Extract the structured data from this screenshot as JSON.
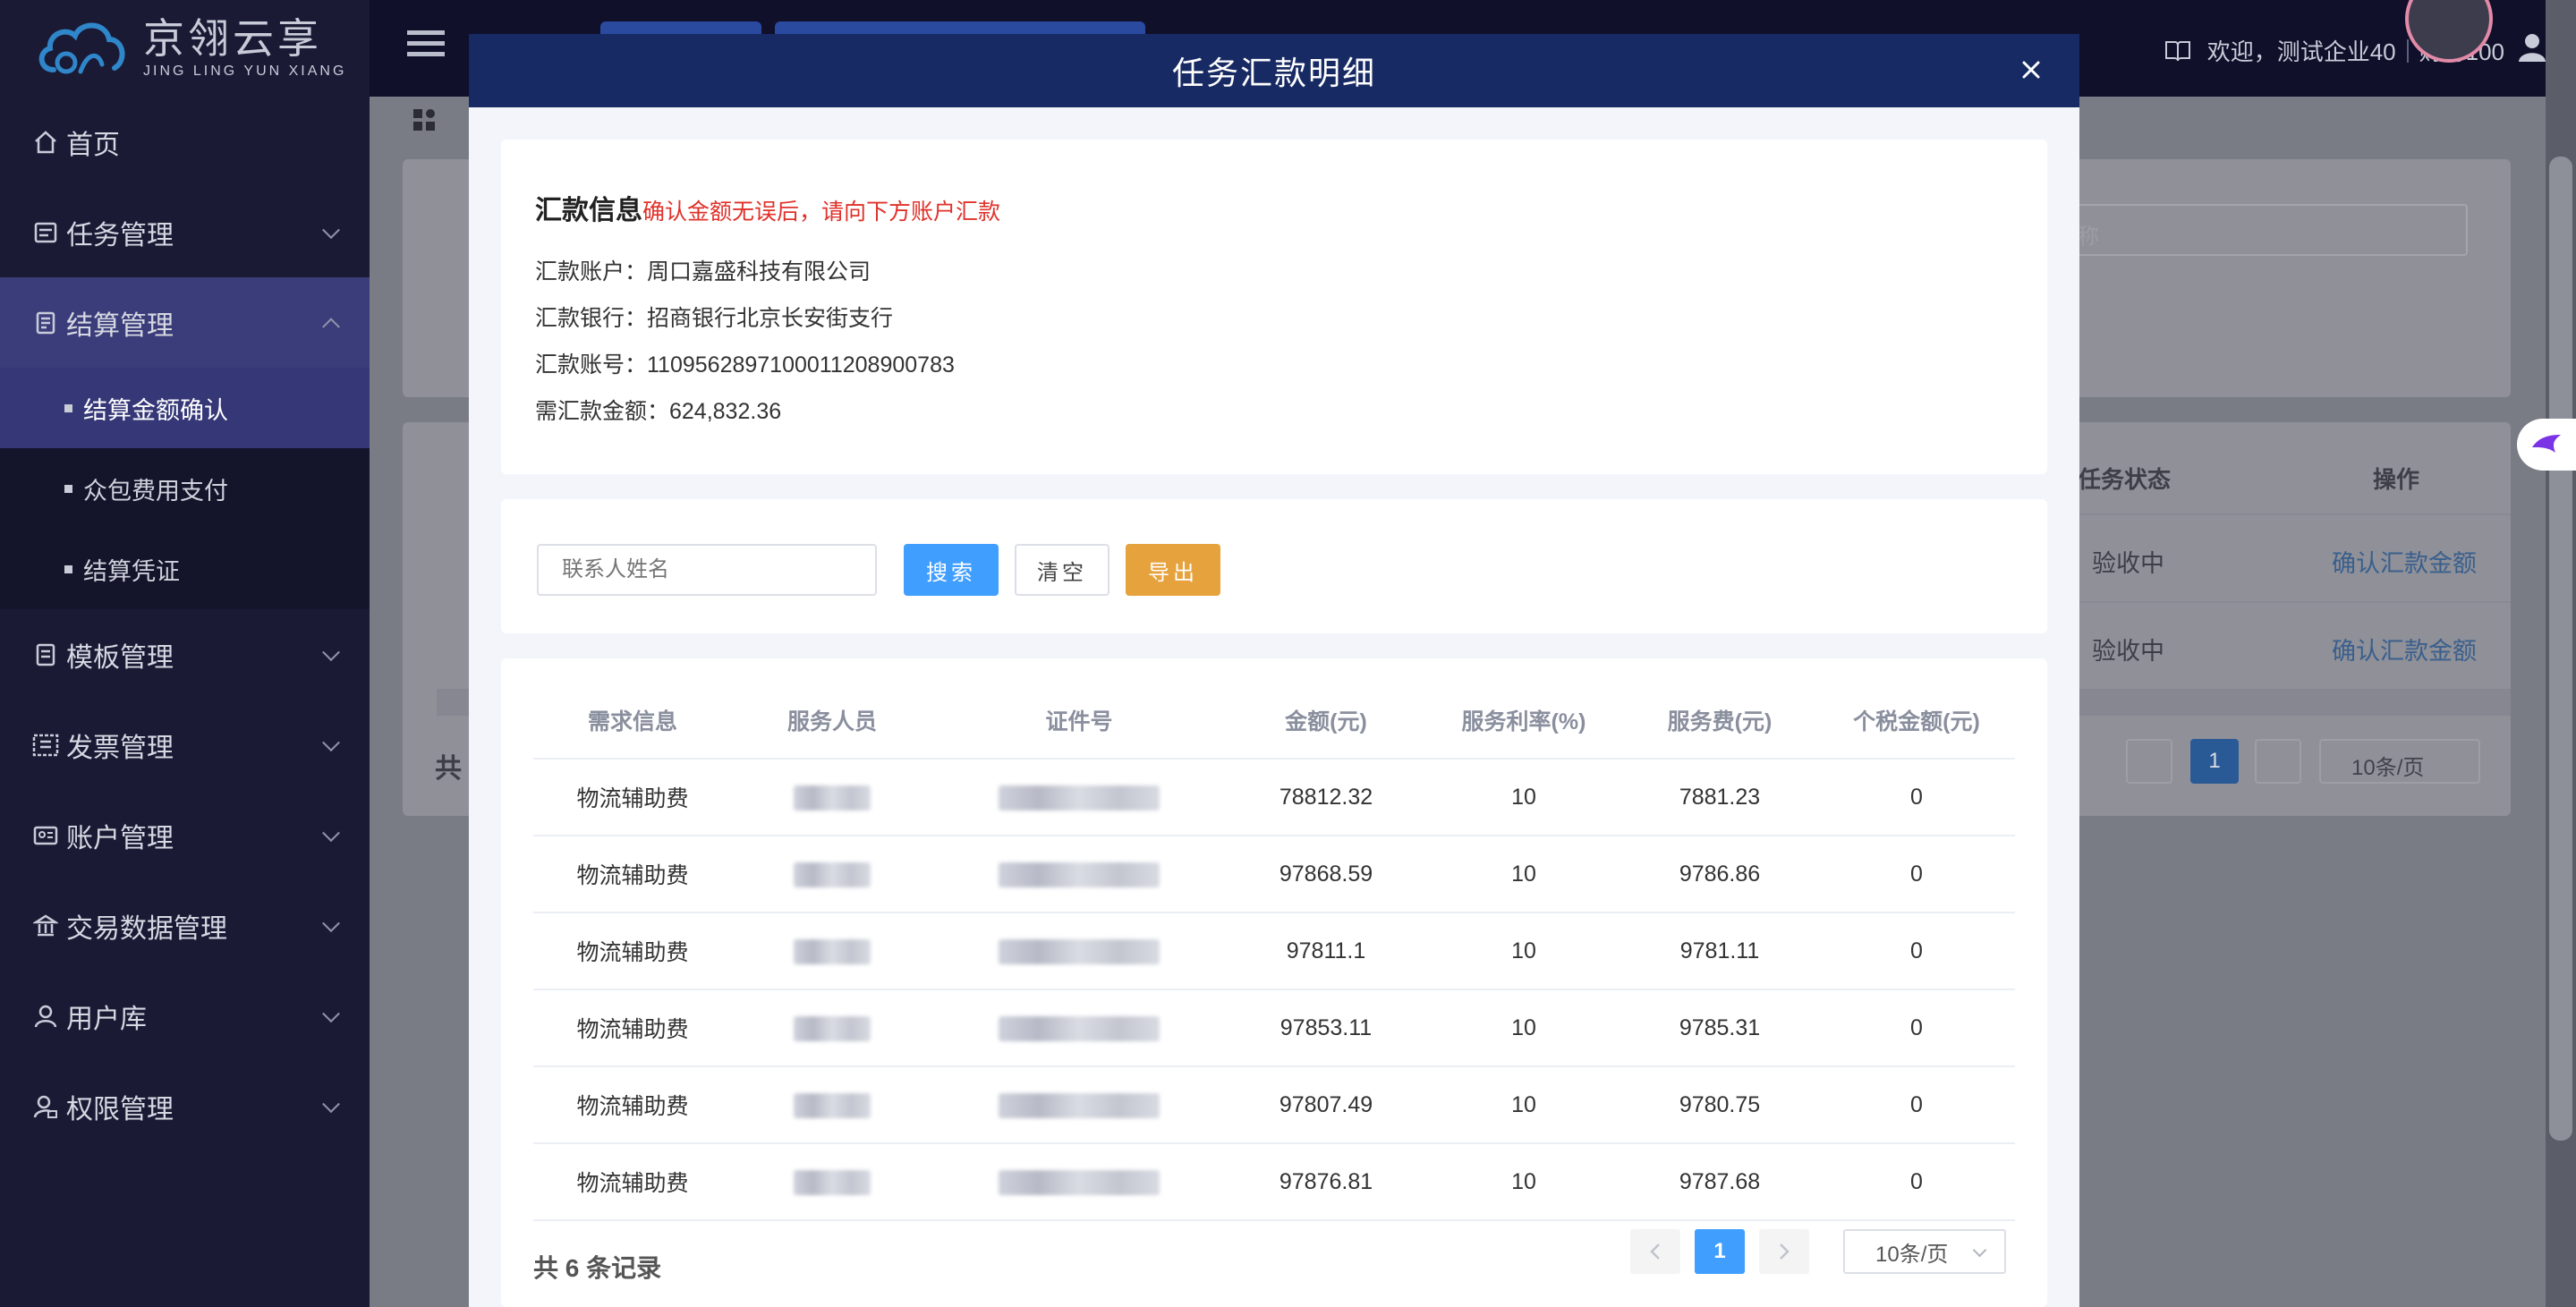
{
  "app": {
    "logo_cn": "京翎云享",
    "logo_en": "JING LING YUN XIANG"
  },
  "header": {
    "welcome": "欢迎，测试企业40",
    "role": "财务100"
  },
  "sidebar": {
    "items": [
      {
        "label": "首页",
        "icon": "home-icon"
      },
      {
        "label": "任务管理",
        "icon": "task-icon"
      },
      {
        "label": "结算管理",
        "icon": "settlement-icon",
        "expanded": true,
        "children": [
          {
            "label": "结算金额确认",
            "active": true
          },
          {
            "label": "众包费用支付"
          },
          {
            "label": "结算凭证"
          }
        ]
      },
      {
        "label": "模板管理",
        "icon": "template-icon"
      },
      {
        "label": "发票管理",
        "icon": "invoice-icon"
      },
      {
        "label": "账户管理",
        "icon": "account-icon"
      },
      {
        "label": "交易数据管理",
        "icon": "bank-icon"
      },
      {
        "label": "用户库",
        "icon": "user-icon"
      },
      {
        "label": "权限管理",
        "icon": "permission-icon"
      }
    ]
  },
  "background": {
    "search_placeholder_tail": "称",
    "col_status": "任务状态",
    "col_action": "操作",
    "rows": [
      {
        "status": "验收中",
        "action": "确认汇款金额"
      },
      {
        "status": "验收中",
        "action": "确认汇款金额"
      }
    ],
    "total_prefix": "共",
    "page_current": "1",
    "page_size": "10条/页"
  },
  "modal": {
    "title": "任务汇款明细",
    "info": {
      "heading": "汇款信息",
      "note": "确认金额无误后，请向下方账户汇款",
      "account_line": "汇款账户：周口嘉盛科技有限公司",
      "bank_line": "汇款银行：招商银行北京长安街支行",
      "number_line": "汇款账号：110956289710001120890078​3",
      "amount_line": "需汇款金额：624,832.36"
    },
    "search": {
      "placeholder": "联系人姓名",
      "search_btn": "搜索",
      "clear_btn": "清空",
      "export_btn": "导出"
    },
    "table": {
      "headers": [
        "需求信息",
        "服务人员",
        "证件号",
        "金额(元)",
        "服务利率(%)",
        "服务费(元)",
        "个税金额(元)"
      ],
      "rows": [
        {
          "demand": "物流辅助费",
          "amount": "78812.32",
          "rate": "10",
          "fee": "7881.23",
          "tax": "0"
        },
        {
          "demand": "物流辅助费",
          "amount": "97868.59",
          "rate": "10",
          "fee": "9786.86",
          "tax": "0"
        },
        {
          "demand": "物流辅助费",
          "amount": "97811.1",
          "rate": "10",
          "fee": "9781.11",
          "tax": "0"
        },
        {
          "demand": "物流辅助费",
          "amount": "97853.11",
          "rate": "10",
          "fee": "9785.31",
          "tax": "0"
        },
        {
          "demand": "物流辅助费",
          "amount": "97807.49",
          "rate": "10",
          "fee": "9780.75",
          "tax": "0"
        },
        {
          "demand": "物流辅助费",
          "amount": "97876.81",
          "rate": "10",
          "fee": "9787.68",
          "tax": "0"
        }
      ]
    },
    "footer": {
      "total": "共 6 条记录",
      "page_current": "1",
      "page_size": "10条/页"
    }
  },
  "colors": {
    "sidebar_bg": "#1a1a35",
    "modal_header": "#172a63",
    "primary": "#409eff",
    "warning": "#e6a23c",
    "danger_text": "#e0322b"
  }
}
